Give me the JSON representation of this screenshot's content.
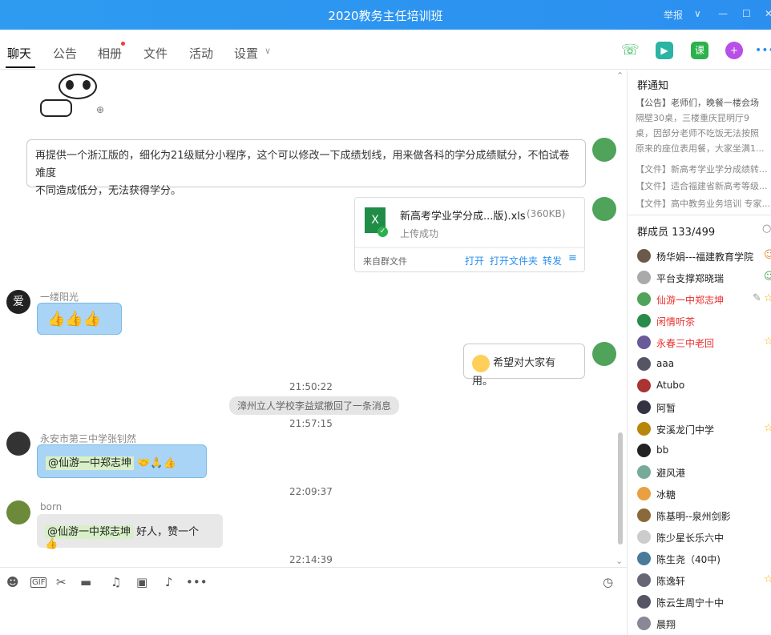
{
  "window": {
    "title": "2020教务主任培训班",
    "report": "举报",
    "minimize": "—",
    "maximize": "☐",
    "close": "✕"
  },
  "tabs": [
    "聊天",
    "公告",
    "相册",
    "文件",
    "活动",
    "设置"
  ],
  "messages": {
    "m1": "再提供一个浙江版的，细化为21级赋分小程序，这个可以修改一下成绩划线，用来做各科的学分成绩赋分，不怕试卷难度",
    "m1b": "不同造成低分，无法获得学分。",
    "file_name": "新高考学业学分成...版).xls",
    "file_size": "(360KB)",
    "file_status": "上传成功",
    "file_source": "来自群文件",
    "file_open": "打开",
    "file_open_folder": "打开文件夹",
    "file_forward": "转发",
    "sender_1": "一缕阳光",
    "msg_hope": "希望对大家有用。",
    "time_1": "21:50:22",
    "sys_recall": "漳州立人学校李益斌撤回了一条消息",
    "time_2": "21:57:15",
    "sender_2": "永安市第三中学张钊然",
    "mention_1": "@仙游一中郑志坤",
    "time_3": "22:09:37",
    "sender_3": "born",
    "mention_2": "@仙游一中郑志坤",
    "msg_born": "好人，赞一个",
    "time_4": "22:14:39",
    "avatar_char": "爱"
  },
  "notice": {
    "title": "群通知",
    "lines": [
      "【公告】老师们，晚餐一楼会场",
      "隔壁30桌，三楼重庆昆明厅9",
      "桌，因部分老师不吃饭无法按照",
      "原来的座位表用餐，大家坐满1...",
      "【文件】新高考学业学分成绩转...",
      "【文件】适合福建省新高考等级...",
      "【文件】高中教务业务培训 专家..."
    ]
  },
  "members": {
    "title": "群成员 133/499",
    "list": [
      "杨华娟---福建教育学院",
      "平台支撑郑晓瑞",
      "仙游一中郑志坤",
      "闲情听茶",
      "永春三中老回",
      "aaa",
      "Atubo",
      "阿暂",
      "安溪龙门中学",
      "bb",
      "避风港",
      "冰糖",
      "陈基明--泉州剑影",
      "陈少星长乐六中",
      "陈生尧（40中)",
      "陈逸轩",
      "陈云生周宁十中",
      "晨翔"
    ]
  }
}
